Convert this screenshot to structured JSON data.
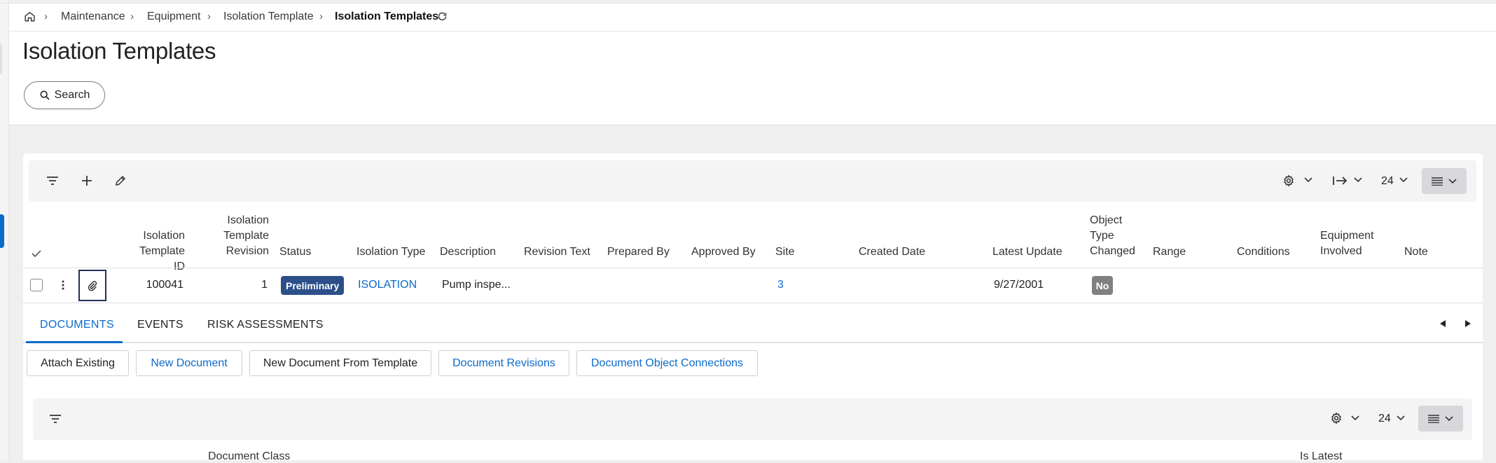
{
  "breadcrumb": {
    "items": [
      "Maintenance",
      "Equipment",
      "Isolation Template"
    ],
    "current": "Isolation Templates"
  },
  "page": {
    "title": "Isolation Templates",
    "search_label": "Search"
  },
  "toolbar": {
    "page_size": "24"
  },
  "table": {
    "headers": {
      "template_id": [
        "Isolation",
        "Template ID"
      ],
      "revision": [
        "Isolation",
        "Template",
        "Revision"
      ],
      "status": "Status",
      "isolation_type": "Isolation Type",
      "description": "Description",
      "revision_text": "Revision Text",
      "prepared_by": "Prepared By",
      "approved_by": "Approved By",
      "site": "Site",
      "created_date": "Created Date",
      "latest_update": "Latest Update",
      "object_type_changed": [
        "Object",
        "Type",
        "Changed"
      ],
      "range": "Range",
      "conditions": "Conditions",
      "equipment_involved": [
        "Equipment",
        "Involved"
      ],
      "note": "Note"
    },
    "rows": [
      {
        "template_id": "100041",
        "revision": "1",
        "status": "Preliminary",
        "isolation_type": "ISOLATION",
        "description": "Pump inspe...",
        "site": "3",
        "latest_update": "9/27/2001",
        "object_type_changed": "No"
      }
    ]
  },
  "subtabs": [
    "DOCUMENTS",
    "EVENTS",
    "RISK ASSESSMENTS"
  ],
  "document_actions": [
    "Attach Existing",
    "New Document",
    "New Document From Template",
    "Document Revisions",
    "Document Object Connections"
  ],
  "documents_toolbar": {
    "page_size": "24"
  },
  "documents_table": {
    "headers": [
      "Document Class",
      "Is Latest"
    ]
  },
  "colors": {
    "accent": "#0b6bcb",
    "status_preliminary": "#2c4f8a",
    "badge_no": "#808080"
  }
}
